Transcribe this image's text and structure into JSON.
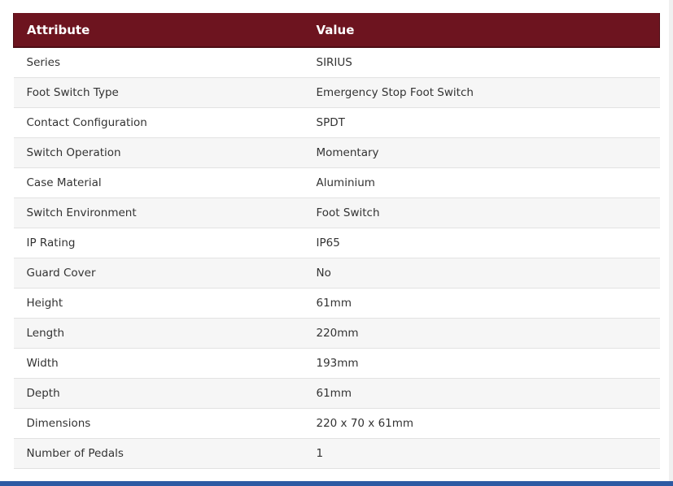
{
  "table": {
    "headers": [
      "Attribute",
      "Value"
    ],
    "rows": [
      [
        "Series",
        "SIRIUS"
      ],
      [
        "Foot Switch Type",
        "Emergency Stop Foot Switch"
      ],
      [
        "Contact Configuration",
        "SPDT"
      ],
      [
        "Switch Operation",
        "Momentary"
      ],
      [
        "Case Material",
        "Aluminium"
      ],
      [
        "Switch Environment",
        "Foot Switch"
      ],
      [
        "IP Rating",
        "IP65"
      ],
      [
        "Guard Cover",
        "No"
      ],
      [
        "Height",
        "61mm"
      ],
      [
        "Length",
        "220mm"
      ],
      [
        "Width",
        "193mm"
      ],
      [
        "Depth",
        "61mm"
      ],
      [
        "Dimensions",
        "220 x 70 x 61mm"
      ],
      [
        "Number of Pedals",
        "1"
      ]
    ]
  },
  "colors": {
    "header_background": "#6d141f",
    "header_text": "#ffffff",
    "row_alt": "#f6f6f6",
    "bottom_bar": "#2d5aa3"
  }
}
